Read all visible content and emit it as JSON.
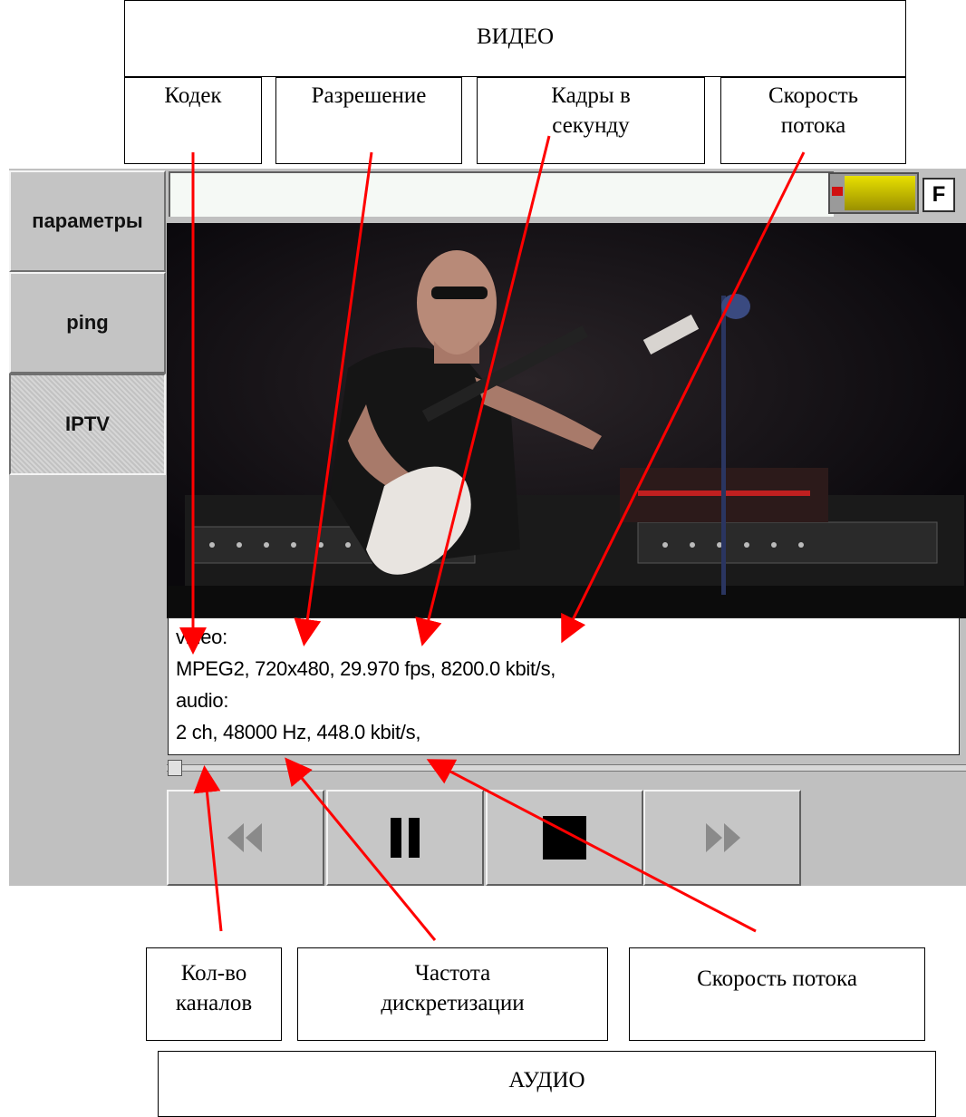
{
  "annotations": {
    "video_title": "ВИДЕО",
    "codec": "Кодек",
    "resolution": "Разрешение",
    "fps_line1": "Кадры в",
    "fps_line2": "секунду",
    "video_bitrate_line1": "Скорость",
    "video_bitrate_line2": "потока",
    "channels_line1": "Кол-во",
    "channels_line2": "каналов",
    "samplerate_line1": "Частота",
    "samplerate_line2": "дискретизации",
    "audio_bitrate": "Скорость потока",
    "audio_title": "АУДИО",
    "arrow_color": "#ff0000"
  },
  "sidebar": {
    "tabs": [
      {
        "label": "параметры",
        "active": false
      },
      {
        "label": "ping",
        "active": false
      },
      {
        "label": "IPTV",
        "active": true
      }
    ]
  },
  "toolbar": {
    "f_button": "F",
    "level_color": "#d8d000"
  },
  "info": {
    "video_label": "video:",
    "video_details": "MPEG2, 720x480, 29.970 fps, 8200.0 kbit/s,",
    "audio_label": "audio:",
    "audio_details": "2 ch, 48000 Hz, 448.0 kbit/s,"
  },
  "playback": {
    "progress": 0.0,
    "buttons": [
      {
        "name": "rewind",
        "icon": "rewind-icon",
        "enabled": false
      },
      {
        "name": "pause",
        "icon": "pause-icon",
        "enabled": true
      },
      {
        "name": "stop",
        "icon": "stop-icon",
        "enabled": true
      },
      {
        "name": "forward",
        "icon": "fast-forward-icon",
        "enabled": false
      }
    ]
  }
}
